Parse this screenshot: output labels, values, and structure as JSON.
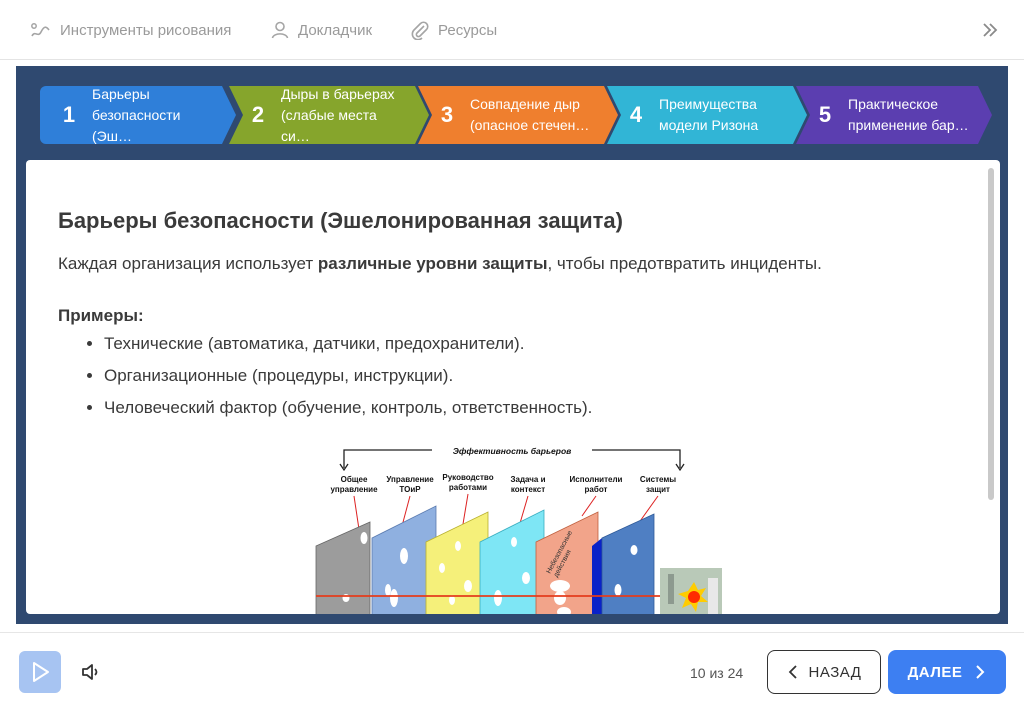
{
  "toolbar": {
    "draw_tools": "Инструменты рисования",
    "speaker": "Докладчик",
    "resources": "Ресурсы",
    "icons": [
      "pen-tool-icon",
      "user-icon",
      "paperclip-icon",
      "chevrons-right-icon"
    ]
  },
  "steps": [
    {
      "num": "1",
      "label": "Барьеры безопасности (Эш…",
      "color": "#2f7fd9"
    },
    {
      "num": "2",
      "label": "Дыры в барьерах (слабые места си…",
      "color": "#86a52c"
    },
    {
      "num": "3",
      "label": "Совпадение дыр (опасное стечен…",
      "color": "#ef7f2e"
    },
    {
      "num": "4",
      "label": "Преимущества модели Ризона",
      "color": "#31b5d6"
    },
    {
      "num": "5",
      "label": "Практическое применение бар…",
      "color": "#5b3eb0"
    }
  ],
  "slide": {
    "title": "Барьеры безопасности (Эшелонированная защита)",
    "intro_before": "Каждая организация использует ",
    "intro_bold": "различные уровни защиты",
    "intro_after": ", чтобы предотвратить инциденты.",
    "examples_heading": "Примеры:",
    "examples": [
      "Технические (автоматика, датчики, предохранители).",
      "Организационные (процедуры, инструкции).",
      "Человеческий фактор (обучение, контроль, ответственность)."
    ]
  },
  "figure": {
    "bracket_label": "Эффективность барьеров",
    "labels": [
      [
        "Общее",
        "управление"
      ],
      [
        "Управление",
        "ТОиР"
      ],
      [
        "Руководство",
        "работами"
      ],
      [
        "Задача и",
        "контекст"
      ],
      [
        "Исполнители",
        "работ"
      ],
      [
        "Системы",
        "защит"
      ]
    ],
    "unsafe_label": [
      "Небезопасные",
      "действия"
    ]
  },
  "footer": {
    "counter": "10 из 24",
    "back": "НАЗАД",
    "next": "ДАЛЕЕ",
    "icons": [
      "play-icon",
      "volume-icon",
      "chevron-left-icon",
      "chevron-right-icon"
    ]
  }
}
